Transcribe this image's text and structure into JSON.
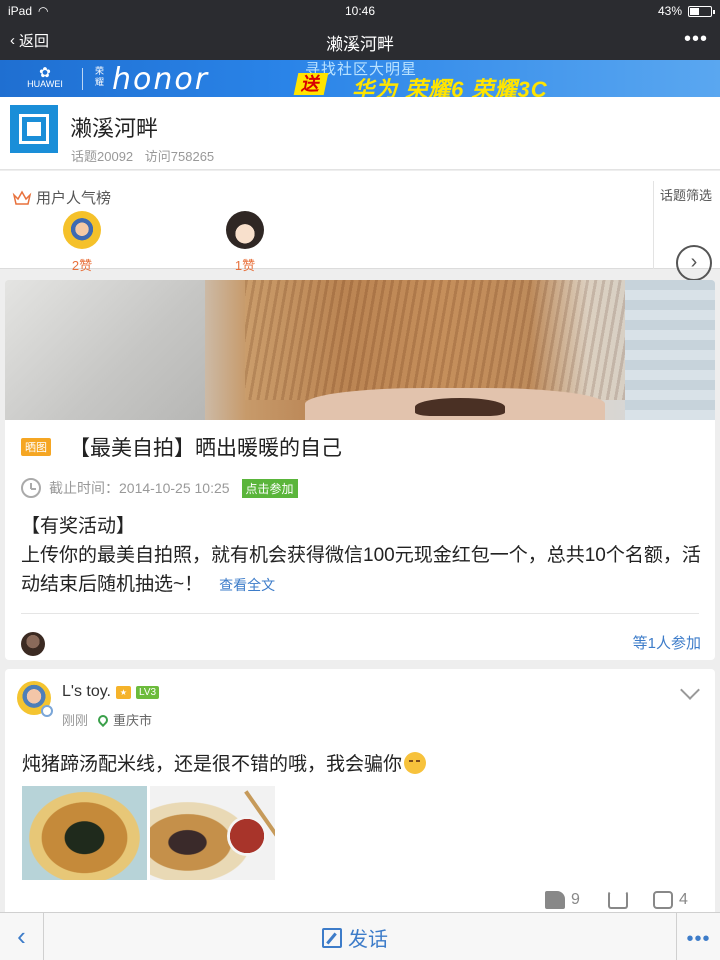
{
  "status_bar": {
    "device": "iPad",
    "time": "10:46",
    "battery_text": "43%",
    "battery_level": 0.43
  },
  "nav": {
    "back_label": "返回",
    "title": "濑溪河畔",
    "more_label": "•••"
  },
  "banner": {
    "brand_small": "HUAWEI",
    "brand_cn": "荣耀",
    "brand": "honor",
    "tagline": "寻找社区大明星",
    "send_label": "送",
    "promo": "华为 荣耀6 荣耀3C"
  },
  "forum": {
    "name": "濑溪河畔",
    "topics_label": "话题20092",
    "visits_label": "访问758265"
  },
  "popularity": {
    "title": "用户人气榜",
    "users": [
      {
        "likes": "2赞",
        "avatar": "cartoon-avatar-yellow"
      },
      {
        "likes": "1赞",
        "avatar": "cartoon-avatar-boy"
      }
    ],
    "filter_label": "话题筛选",
    "filter_arrow": "›"
  },
  "event": {
    "tag": "晒图",
    "title": "【最美自拍】晒出暖暖的自己",
    "deadline_label": "截止时间：",
    "deadline": "2014-10-25 10:25",
    "join_label": "点击参加",
    "body_heading": "【有奖活动】",
    "body": "上传你的最美自拍照，就有机会获得微信100元现金红包一个，总共10个名额，活动结束后随机抽选~！",
    "read_more": "查看全文",
    "participants": "等1人参加"
  },
  "post": {
    "username": "L's toy.",
    "level": "LV3",
    "time": "刚刚",
    "location": "重庆市",
    "text": "炖猪蹄汤配米线，还是很不错的哦，我会骗你",
    "likes": "9",
    "comments": "4"
  },
  "bottom_bar": {
    "back_icon": "‹",
    "post_label": "发话",
    "more_label": "•••"
  },
  "colors": {
    "nav_bg": "#2b2c30",
    "accent_blue": "#3d7cc9",
    "forum_logo": "#1a8ed8",
    "like_orange": "#e8713c",
    "join_green": "#5ab53b",
    "tag_orange": "#f5a623"
  }
}
